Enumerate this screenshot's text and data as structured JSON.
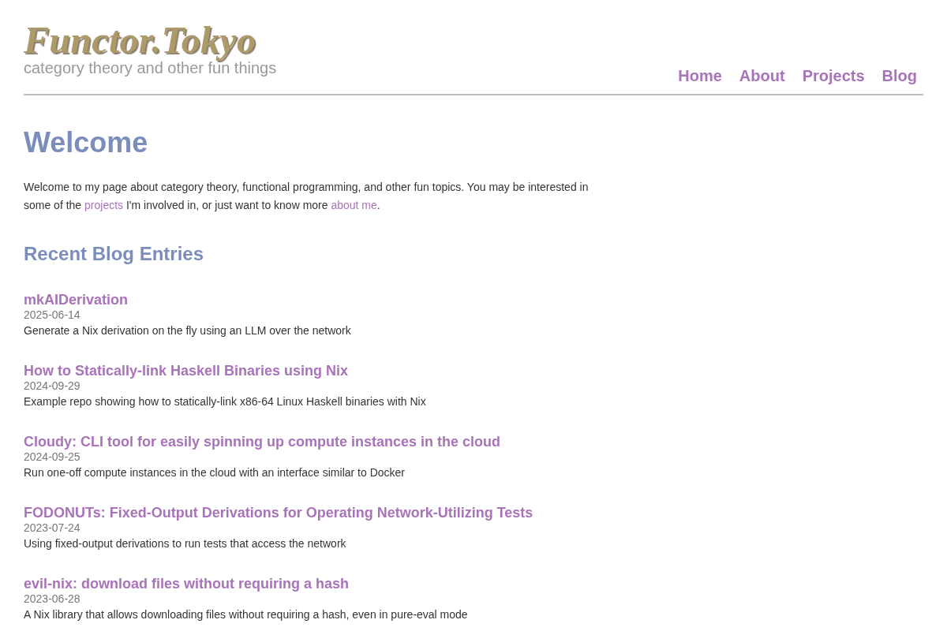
{
  "header": {
    "logo": "Functor.Tokyo",
    "tagline": "category theory and other fun things",
    "nav": [
      {
        "label": "Home"
      },
      {
        "label": "About"
      },
      {
        "label": "Projects"
      },
      {
        "label": "Blog"
      }
    ]
  },
  "page_title": "Welcome",
  "intro": [
    {
      "kind": "text",
      "text": "Welcome to my page about category theory, functional programming, and other fun topics. You may be interested in some of the "
    },
    {
      "kind": "link",
      "text": "projects"
    },
    {
      "kind": "text",
      "text": " I'm involved in, or just want to know more "
    },
    {
      "kind": "link",
      "text": "about me"
    },
    {
      "kind": "text",
      "text": "."
    }
  ],
  "blog_heading": "Recent Blog Entries",
  "entries": [
    {
      "title": "mkAIDerivation",
      "date": "2025-06-14",
      "summary": "Generate a Nix derivation on the fly using an LLM over the network"
    },
    {
      "title": "How to Statically-link Haskell Binaries using Nix",
      "date": "2024-09-29",
      "summary": "Example repo showing how to statically-link x86-64 Linux Haskell binaries with Nix"
    },
    {
      "title": "Cloudy: CLI tool for easily spinning up compute instances in the cloud",
      "date": "2024-09-25",
      "summary": "Run one-off compute instances in the cloud with an interface similar to Docker"
    },
    {
      "title": "FODONUTs: Fixed-Output Derivations for Operating Network-Utilizing Tests",
      "date": "2023-07-24",
      "summary": "Using fixed-output derivations to run tests that access the network"
    },
    {
      "title": "evil-nix: download files without requiring a hash",
      "date": "2023-06-28",
      "summary": "A Nix library that allows downloading files without requiring a hash, even in pure-eval mode"
    }
  ]
}
